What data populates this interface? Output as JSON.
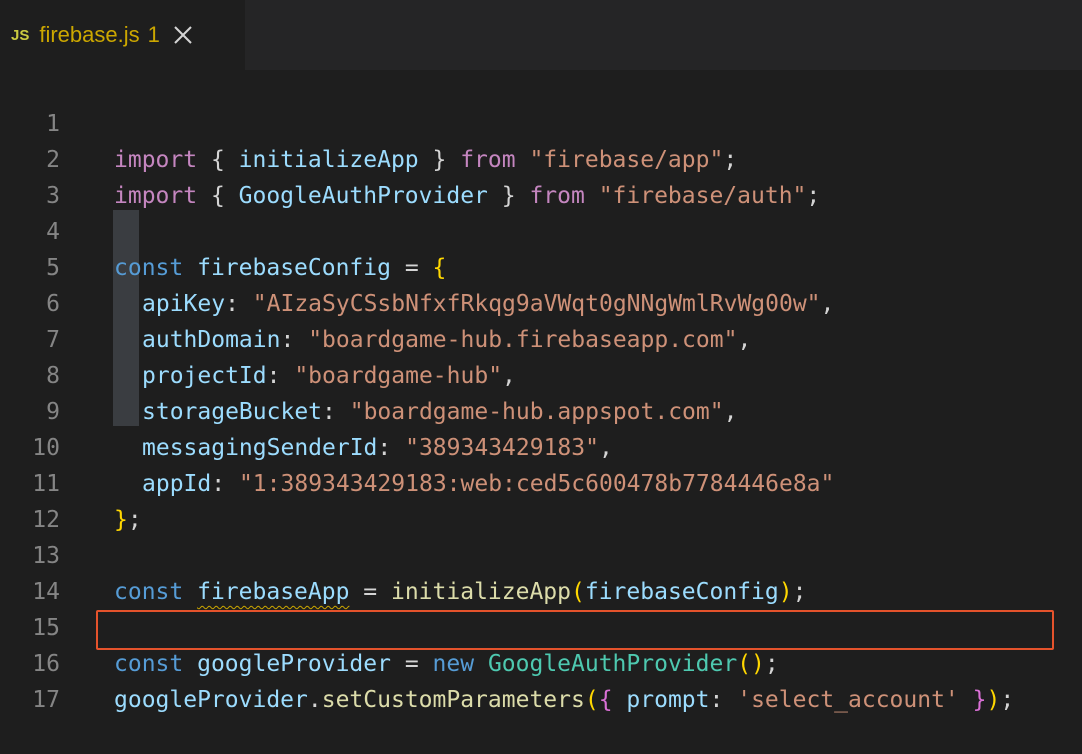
{
  "tab": {
    "icon_label": "JS",
    "filename": "firebase.js",
    "problem_count": "1"
  },
  "editor": {
    "line_numbers": [
      "1",
      "2",
      "3",
      "4",
      "5",
      "6",
      "7",
      "8",
      "9",
      "10",
      "11",
      "12",
      "13",
      "14",
      "15",
      "16",
      "17"
    ],
    "l1": {
      "import": "import",
      "open": " { ",
      "name": "initializeApp",
      "close": " } ",
      "from": "from",
      "sp": " ",
      "src": "\"firebase/app\"",
      "end": ";"
    },
    "l2": {
      "import": "import",
      "open": " { ",
      "name": "GoogleAuthProvider",
      "close": " } ",
      "from": "from",
      "sp": " ",
      "src": "\"firebase/auth\"",
      "end": ";"
    },
    "l4": {
      "const": "const",
      "sp": " ",
      "name": "firebaseConfig",
      "eq": " = ",
      "brace": "{"
    },
    "config": [
      {
        "key": "apiKey",
        "colon": ": ",
        "value": "\"AIzaSyCSsbNfxfRkqg9aVWqt0gNNgWmlRvWg00w\"",
        "comma": ","
      },
      {
        "key": "authDomain",
        "colon": ": ",
        "value": "\"boardgame-hub.firebaseapp.com\"",
        "comma": ","
      },
      {
        "key": "projectId",
        "colon": ": ",
        "value": "\"boardgame-hub\"",
        "comma": ","
      },
      {
        "key": "storageBucket",
        "colon": ": ",
        "value": "\"boardgame-hub.appspot.com\"",
        "comma": ","
      },
      {
        "key": "messagingSenderId",
        "colon": ": ",
        "value": "\"389343429183\"",
        "comma": ","
      },
      {
        "key": "appId",
        "colon": ": ",
        "value": "\"1:389343429183:web:ced5c600478b7784446e8a\"",
        "comma": ""
      }
    ],
    "l11": {
      "brace": "}",
      "end": ";"
    },
    "l13": {
      "const": "const",
      "sp": " ",
      "name": "firebaseApp",
      "eq": " = ",
      "fn": "initializeApp",
      "open": "(",
      "arg": "firebaseConfig",
      "close": ")",
      "end": ";"
    },
    "l15": {
      "const": "const",
      "sp": " ",
      "name": "googleProvider",
      "eq": " = ",
      "new": "new",
      "sp2": " ",
      "cls": "GoogleAuthProvider",
      "parens": "()",
      "end": ";"
    },
    "l16": {
      "obj": "googleProvider",
      "dot": ".",
      "method": "setCustomParameters",
      "open": "(",
      "brace_open": "{",
      "sp": " ",
      "key": "prompt",
      "colon": ": ",
      "value": "'select_account'",
      "brace_close": " }",
      "close": ")",
      "end": ";"
    }
  },
  "colors": {
    "background": "#1e1e1e",
    "keyword": "#569cd6",
    "control_keyword": "#c586c0",
    "string": "#ce9178",
    "variable": "#9cdcfe",
    "function": "#dcdcaa",
    "class": "#4ec9b0",
    "highlight_border": "#e5532c",
    "warning": "#cca700"
  }
}
